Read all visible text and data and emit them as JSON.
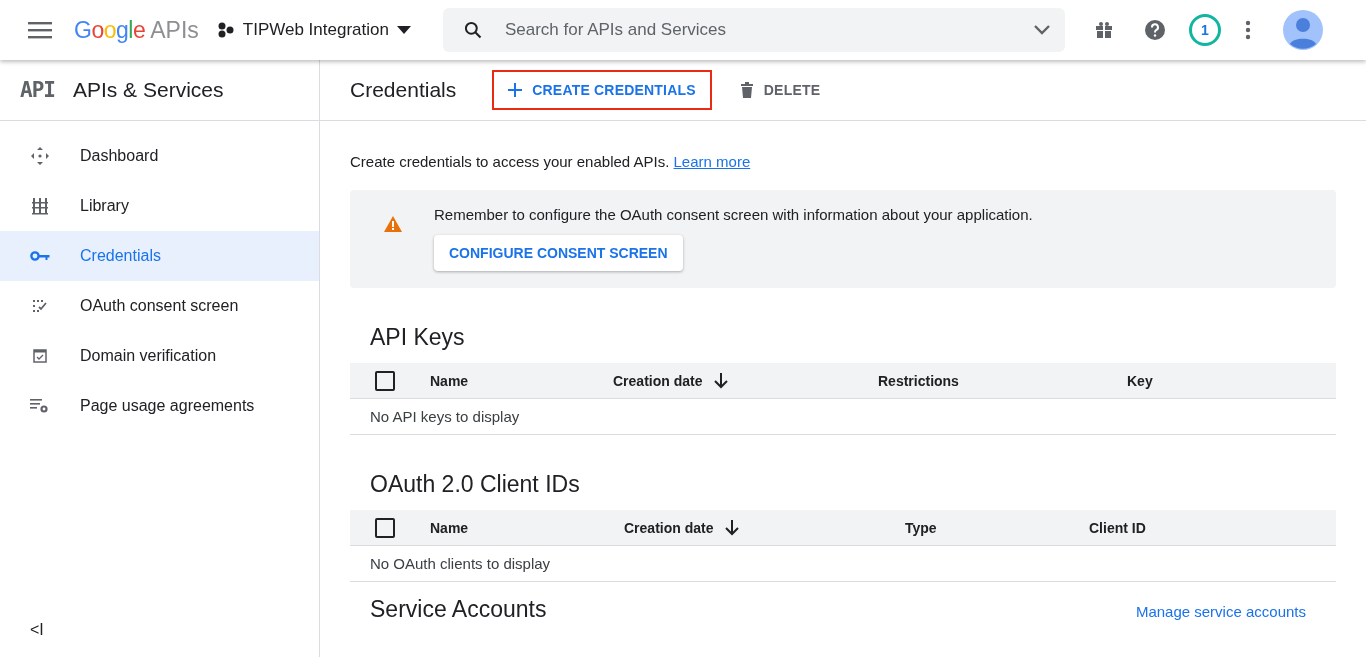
{
  "header": {
    "logo_brand": "Google",
    "logo_product": "APIs",
    "project": "TIPWeb Integration",
    "search": {
      "placeholder": "Search for APIs and Services"
    },
    "notification_count": "1"
  },
  "sidebar": {
    "badge": "API",
    "title": "APIs & Services",
    "items": [
      {
        "label": "Dashboard",
        "kind": "dashboard",
        "selected": false
      },
      {
        "label": "Library",
        "kind": "library",
        "selected": false
      },
      {
        "label": "Credentials",
        "kind": "key",
        "selected": true
      },
      {
        "label": "OAuth consent screen",
        "kind": "consent",
        "selected": false
      },
      {
        "label": "Domain verification",
        "kind": "domain",
        "selected": false
      },
      {
        "label": "Page usage agreements",
        "kind": "agreements",
        "selected": false
      }
    ],
    "collapse": "<I"
  },
  "page": {
    "title": "Credentials",
    "actions": [
      {
        "label": "CREATE CREDENTIALS",
        "kind": "create",
        "highlighted": true,
        "disabled": false
      },
      {
        "label": "DELETE",
        "kind": "delete",
        "highlighted": false,
        "disabled": true
      }
    ],
    "intro": "Create credentials to access your enabled APIs.",
    "intro_link": "Learn more",
    "alert": {
      "text": "Remember to configure the OAuth consent screen with information about your application.",
      "button": "CONFIGURE CONSENT SCREEN"
    },
    "sections": [
      {
        "title": "API Keys",
        "checked": false,
        "columns": [
          {
            "label": "Name",
            "sorted": false
          },
          {
            "label": "Creation date",
            "sorted": true
          },
          {
            "label": "Restrictions",
            "sorted": false
          },
          {
            "label": "Key",
            "sorted": false
          }
        ],
        "empty": "No API keys to display"
      },
      {
        "title": "OAuth 2.0 Client IDs",
        "checked": false,
        "columns": [
          {
            "label": "Name",
            "sorted": false
          },
          {
            "label": "Creation date",
            "sorted": true
          },
          {
            "label": "Type",
            "sorted": false
          },
          {
            "label": "Client ID",
            "sorted": false
          }
        ],
        "empty": "No OAuth clients to display"
      }
    ],
    "next_section": {
      "title": "Service Accounts",
      "link": "Manage service accounts"
    }
  }
}
